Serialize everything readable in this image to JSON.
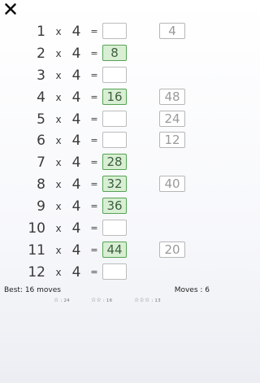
{
  "close": {
    "icon": "close-icon"
  },
  "operator": "x",
  "equals": "=",
  "rows": [
    {
      "a": "1",
      "b": "4",
      "answer": "",
      "tile": "4"
    },
    {
      "a": "2",
      "b": "4",
      "answer": "8",
      "tile": ""
    },
    {
      "a": "3",
      "b": "4",
      "answer": "",
      "tile": ""
    },
    {
      "a": "4",
      "b": "4",
      "answer": "16",
      "tile": "48"
    },
    {
      "a": "5",
      "b": "4",
      "answer": "",
      "tile": "24"
    },
    {
      "a": "6",
      "b": "4",
      "answer": "",
      "tile": "12"
    },
    {
      "a": "7",
      "b": "4",
      "answer": "28",
      "tile": ""
    },
    {
      "a": "8",
      "b": "4",
      "answer": "32",
      "tile": "40"
    },
    {
      "a": "9",
      "b": "4",
      "answer": "36",
      "tile": ""
    },
    {
      "a": "10",
      "b": "4",
      "answer": "",
      "tile": ""
    },
    {
      "a": "11",
      "b": "4",
      "answer": "44",
      "tile": "20"
    },
    {
      "a": "12",
      "b": "4",
      "answer": "",
      "tile": ""
    }
  ],
  "footer": {
    "best": "Best: 16 moves",
    "moves": "Moves : 6",
    "stars": [
      {
        "glyphs": "☆",
        "label": ": 24"
      },
      {
        "glyphs": "☆☆",
        "label": ": 16"
      },
      {
        "glyphs": "☆☆☆",
        "label": ": 13"
      }
    ]
  },
  "colors": {
    "filled_bg": "#d8efd4",
    "filled_border": "#55a353",
    "tile_text": "#9a9a9a"
  }
}
